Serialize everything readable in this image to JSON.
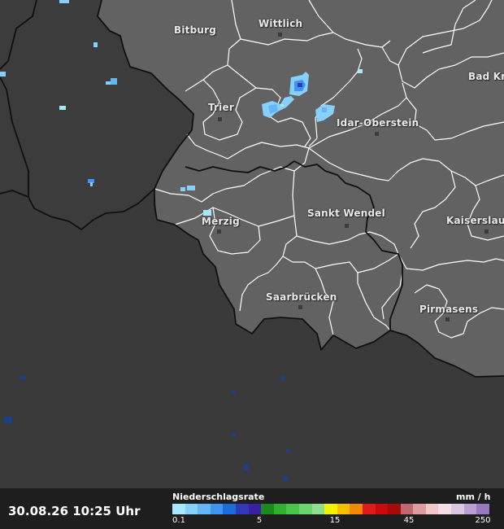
{
  "map": {
    "cities": [
      {
        "name": "Bitburg",
        "id": "bitburg"
      },
      {
        "name": "Wittlich",
        "id": "wittlich"
      },
      {
        "name": "Bad Kr",
        "id": "bad-kr"
      },
      {
        "name": "Trier",
        "id": "trier"
      },
      {
        "name": "Idar-Oberstein",
        "id": "idar-oberstein"
      },
      {
        "name": "Merzig",
        "id": "merzig"
      },
      {
        "name": "Sankt Wendel",
        "id": "sankt-wendel"
      },
      {
        "name": "Kaiserslau",
        "id": "kaiserslau"
      },
      {
        "name": "Saarbrücken",
        "id": "saarbruecken"
      },
      {
        "name": "Pirmasens",
        "id": "pirmasens"
      }
    ],
    "colors": {
      "focus_region": "#626262",
      "outside_region": "#3a3a3a",
      "border": "#ffffff",
      "boundary": "#101010"
    }
  },
  "footer": {
    "timestamp": "30.08.26 10:25 Uhr",
    "legend_title": "Niederschlagsrate",
    "legend_unit": "mm / h",
    "ticks": [
      {
        "label": "0.1",
        "id": "0-1"
      },
      {
        "label": "5",
        "id": "5"
      },
      {
        "label": "15",
        "id": "15"
      },
      {
        "label": "45",
        "id": "45"
      },
      {
        "label": "250",
        "id": "250"
      }
    ],
    "legend_colors": [
      "#a8e8ff",
      "#86d0fb",
      "#64b6f3",
      "#3f95ec",
      "#1d6cdb",
      "#3338b8",
      "#3a1fa0",
      "#1b8a1b",
      "#2fae2f",
      "#4cc44c",
      "#6cd46c",
      "#8ee08e",
      "#f2f200",
      "#f6c000",
      "#f28a00",
      "#e01a1a",
      "#c80c0c",
      "#a80a0a",
      "#c06870",
      "#dc9ca0",
      "#f0c8c8",
      "#f4e0e4",
      "#d8c8e0",
      "#b8a0d0",
      "#9878c0"
    ]
  }
}
